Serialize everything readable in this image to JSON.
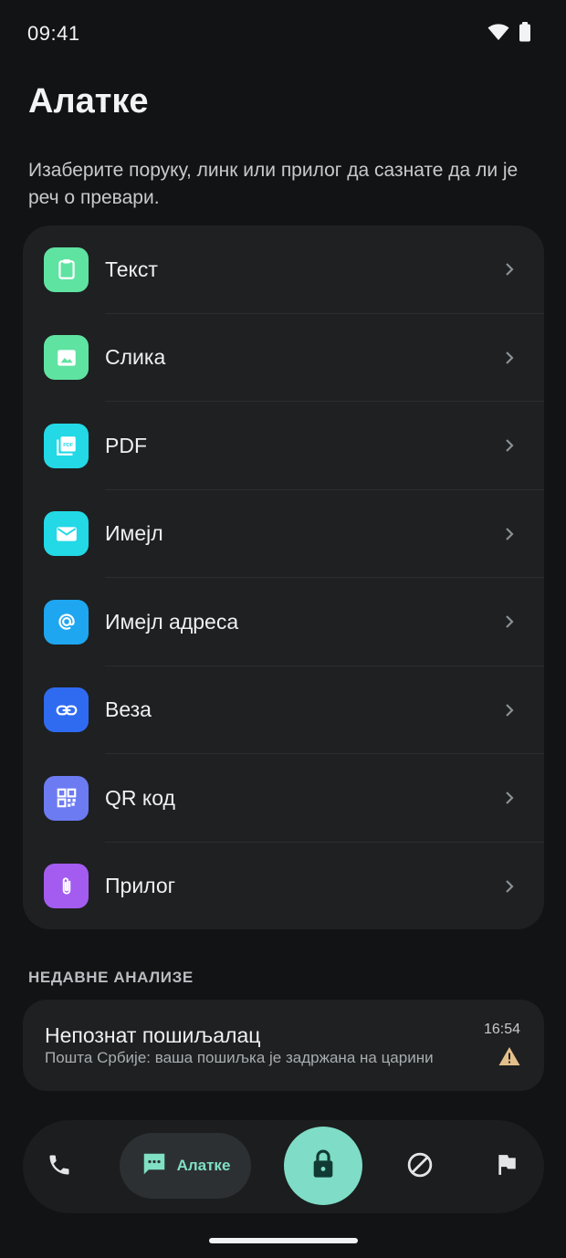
{
  "status_bar": {
    "time": "09:41"
  },
  "header": {
    "title": "Алатке",
    "subtitle": "Изаберите поруку, линк или прилог да сазнате да ли је реч о превари."
  },
  "tools": [
    {
      "label": "Текст",
      "icon": "clipboard-icon",
      "color": "#5fe3a1"
    },
    {
      "label": "Слика",
      "icon": "image-icon",
      "color": "#5fe3a1"
    },
    {
      "label": "PDF",
      "icon": "pdf-icon",
      "color": "#23d9e6"
    },
    {
      "label": "Имејл",
      "icon": "mail-icon",
      "color": "#23d9e6"
    },
    {
      "label": "Имејл адреса",
      "icon": "at-sign-icon",
      "color": "#1ea6f0"
    },
    {
      "label": "Веза",
      "icon": "link-icon",
      "color": "#2f6bf0"
    },
    {
      "label": "QR код",
      "icon": "qr-code-icon",
      "color": "#6c7bf2"
    },
    {
      "label": "Прилог",
      "icon": "paperclip-icon",
      "color": "#a45cf0"
    }
  ],
  "recent": {
    "section_label": "НЕДАВНЕ АНАЛИЗЕ",
    "items": [
      {
        "title": "Непознат пошиљалац",
        "preview": "Пошта Србије: ваша пошиљка је задржана на царини",
        "time": "16:54",
        "status_icon": "warning-icon",
        "status_color": "#e3c08a"
      }
    ]
  },
  "nav": {
    "items": [
      {
        "name": "phone",
        "icon": "phone-icon"
      },
      {
        "name": "tools",
        "icon": "message-icon",
        "label": "Алатке",
        "active": true
      },
      {
        "name": "protect",
        "icon": "lock-icon"
      },
      {
        "name": "block",
        "icon": "block-icon"
      },
      {
        "name": "report",
        "icon": "flag-icon"
      }
    ],
    "accent": "#7fdcc6"
  }
}
